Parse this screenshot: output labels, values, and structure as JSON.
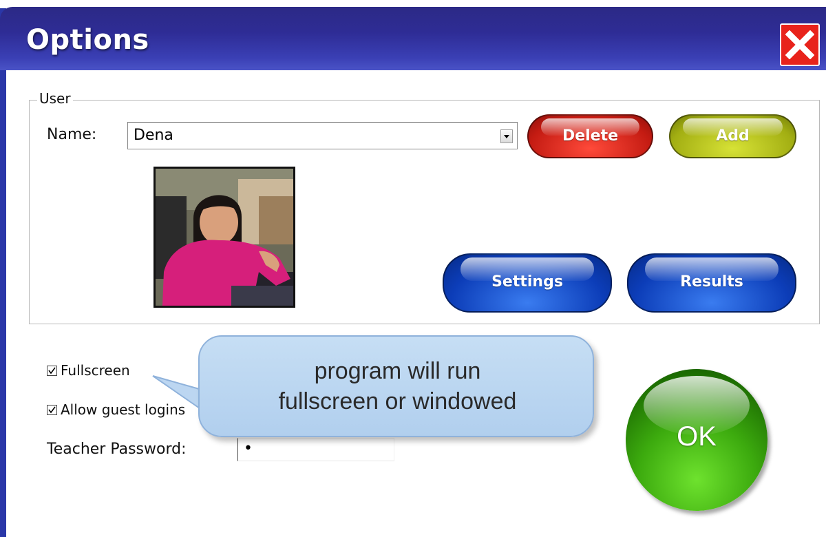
{
  "window": {
    "title": "Options"
  },
  "user_group": {
    "legend": "User",
    "name_label": "Name:",
    "name_value": "Dena",
    "delete_label": "Delete",
    "add_label": "Add",
    "settings_label": "Settings",
    "results_label": "Results"
  },
  "options": {
    "fullscreen_label": "Fullscreen",
    "fullscreen_checked": true,
    "guest_label": "Allow guest logins",
    "guest_checked": true,
    "password_label": "Teacher Password:",
    "password_value": "•"
  },
  "ok_label": "OK",
  "callout": {
    "line1": "program will run",
    "line2": "fullscreen or windowed"
  },
  "colors": {
    "titlebar": "#2e2c95",
    "close": "#e8231b",
    "delete": "#c41b12",
    "add": "#a2ae12",
    "blue_button": "#0c3db8",
    "ok": "#3caa0e",
    "callout": "#c6def4"
  },
  "icons": {
    "close": "close-icon",
    "dropdown": "chevron-down-icon",
    "check": "check-icon"
  }
}
